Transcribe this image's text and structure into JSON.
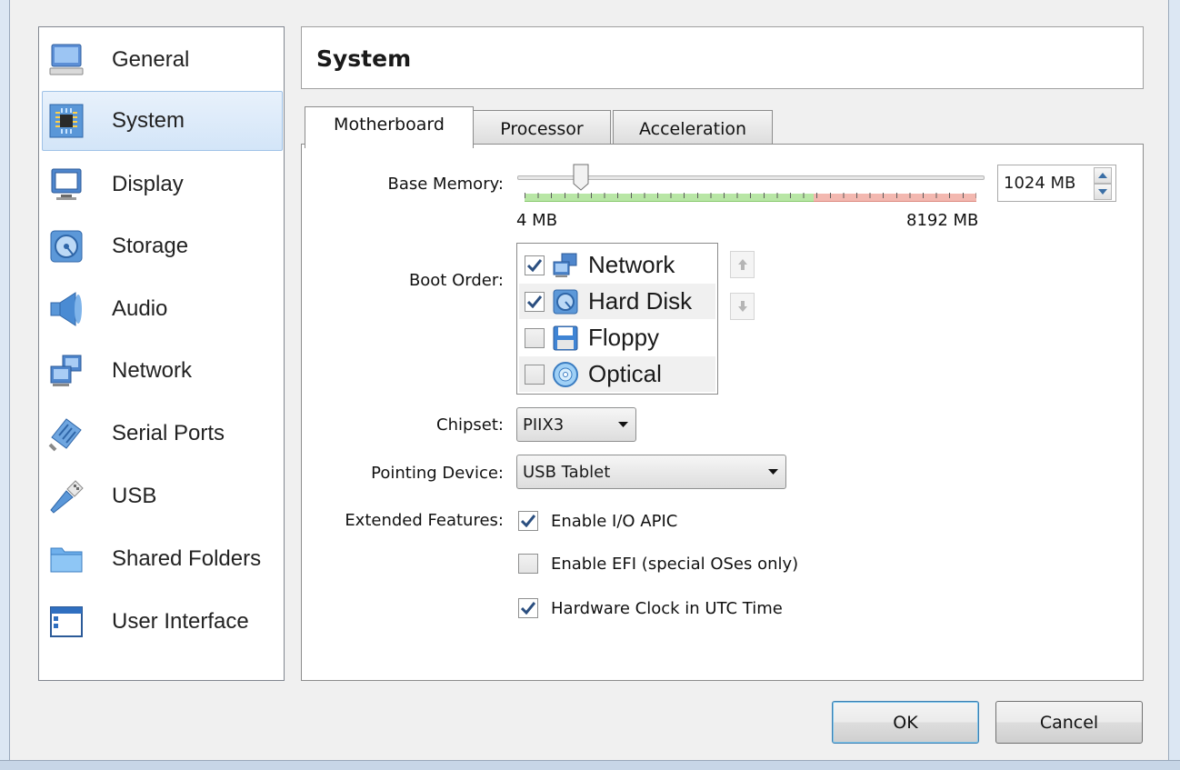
{
  "sidebar": {
    "items": [
      {
        "label": "General",
        "icon": "monitor-icon"
      },
      {
        "label": "System",
        "icon": "chip-icon",
        "selected": true
      },
      {
        "label": "Display",
        "icon": "display-icon"
      },
      {
        "label": "Storage",
        "icon": "storage-icon"
      },
      {
        "label": "Audio",
        "icon": "speaker-icon"
      },
      {
        "label": "Network",
        "icon": "network-icon"
      },
      {
        "label": "Serial Ports",
        "icon": "serial-port-icon"
      },
      {
        "label": "USB",
        "icon": "usb-icon"
      },
      {
        "label": "Shared Folders",
        "icon": "folder-icon"
      },
      {
        "label": "User Interface",
        "icon": "window-icon"
      }
    ]
  },
  "header": {
    "title": "System"
  },
  "tabs": [
    {
      "label": "Motherboard",
      "active": true
    },
    {
      "label": "Processor"
    },
    {
      "label": "Acceleration"
    }
  ],
  "motherboard": {
    "base_memory": {
      "label": "Base Memory:",
      "value": "1024 MB",
      "min_label": "4 MB",
      "max_label": "8192 MB",
      "min_mb": 4,
      "max_mb": 8192,
      "current_mb": 1024,
      "recommended_fraction": 0.64
    },
    "boot_order": {
      "label": "Boot Order:",
      "items": [
        {
          "label": "Network",
          "checked": true,
          "icon": "network-icon"
        },
        {
          "label": "Hard Disk",
          "checked": true,
          "icon": "hard-disk-icon"
        },
        {
          "label": "Floppy",
          "checked": false,
          "icon": "floppy-icon"
        },
        {
          "label": "Optical",
          "checked": false,
          "icon": "optical-disc-icon"
        }
      ]
    },
    "chipset": {
      "label": "Chipset:",
      "value": "PIIX3"
    },
    "pointing_device": {
      "label": "Pointing Device:",
      "value": "USB Tablet"
    },
    "extended_features": {
      "label": "Extended Features:",
      "items": [
        {
          "label": "Enable I/O APIC",
          "checked": true
        },
        {
          "label": "Enable EFI (special OSes only)",
          "checked": false
        },
        {
          "label": "Hardware Clock in UTC Time",
          "checked": true
        }
      ]
    }
  },
  "buttons": {
    "ok": "OK",
    "cancel": "Cancel"
  },
  "colors": {
    "selection": "#d3e5f8",
    "slider_green": "#b8e6a5",
    "slider_red": "#f3b8b0",
    "default_button_border": "#3c7fb1",
    "check_mark": "#2b4f80"
  }
}
